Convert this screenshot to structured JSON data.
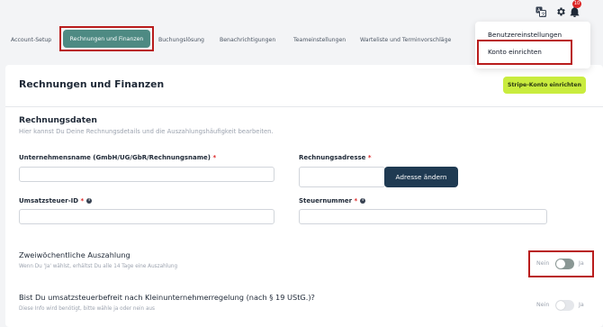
{
  "header": {
    "notification_count": "10",
    "icons": [
      "translate-icon",
      "gear-icon",
      "bell-icon"
    ]
  },
  "tabs": [
    {
      "label": "Account-Setup"
    },
    {
      "label": "Rechnungen und Finanzen",
      "active": true
    },
    {
      "label": "Buchungslösung"
    },
    {
      "label": "Benachrichtigungen"
    },
    {
      "label": "Teameinstellungen"
    },
    {
      "label": "Warteliste und Terminvorschläge"
    }
  ],
  "dropdown": {
    "items": [
      {
        "label": "Benutzereinstellungen"
      },
      {
        "label": "Konto einrichten"
      }
    ]
  },
  "page": {
    "title": "Rechnungen und Finanzen",
    "stripe_button": "Stripe-Konto einrichten"
  },
  "billing": {
    "title": "Rechnungsdaten",
    "subtitle": "Hier kannst Du Deine Rechnungsdetails und die Auszahlungshäufigkeit bearbeiten.",
    "company_label": "Unternehmensname (GmbH/UG/GbR/Rechnungsname)",
    "address_label": "Rechnungsadresse",
    "address_button": "Adresse ändern",
    "vat_label": "Umsatzsteuer-ID",
    "tax_label": "Steuernummer",
    "company_value": "",
    "address_value": "",
    "vat_value": "",
    "tax_value": ""
  },
  "payout": {
    "label": "Zweiwöchentliche Auszahlung",
    "hint": "Wenn Du 'Ja' wählst, erhältst Du alle 14 Tage eine Auszahlung",
    "no": "Nein",
    "yes": "Ja",
    "enabled": false
  },
  "small_business": {
    "label": "Bist Du umsatzsteuerbefreit nach Kleinunternehmerregelung (nach § 19 UStG.)?",
    "hint": "Diese Info wird benötigt, bitte wähle ja oder nein aus",
    "no": "Nein",
    "yes": "Ja",
    "enabled": false
  },
  "colors": {
    "accent": "#4e8a83",
    "stripe": "#c9ec3e",
    "navy": "#1f3a52",
    "highlight": "#b91c1c"
  }
}
